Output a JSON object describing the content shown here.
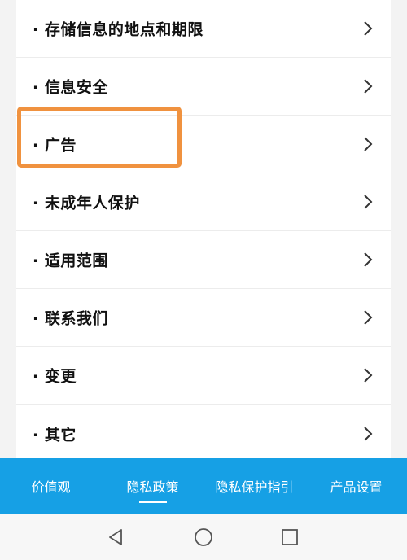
{
  "list": {
    "items": [
      {
        "label": "· 存储信息的地点和期限"
      },
      {
        "label": "· 信息安全"
      },
      {
        "label": "· 广告"
      },
      {
        "label": "· 未成年人保护"
      },
      {
        "label": "· 适用范围"
      },
      {
        "label": "· 联系我们"
      },
      {
        "label": "· 变更"
      },
      {
        "label": "· 其它"
      }
    ],
    "chevron_icon": "chevron-right-icon",
    "highlighted_index": 2,
    "highlight_color": "#F0923F"
  },
  "tabbar": {
    "background": "#16a0e5",
    "tabs": [
      {
        "label": "价值观"
      },
      {
        "label": "隐私政策",
        "active": true
      },
      {
        "label": "隐私保护指引"
      },
      {
        "label": "产品设置"
      }
    ]
  },
  "navbar": {
    "buttons": [
      {
        "icon": "back-triangle-icon"
      },
      {
        "icon": "home-circle-icon"
      },
      {
        "icon": "recents-square-icon"
      }
    ]
  }
}
